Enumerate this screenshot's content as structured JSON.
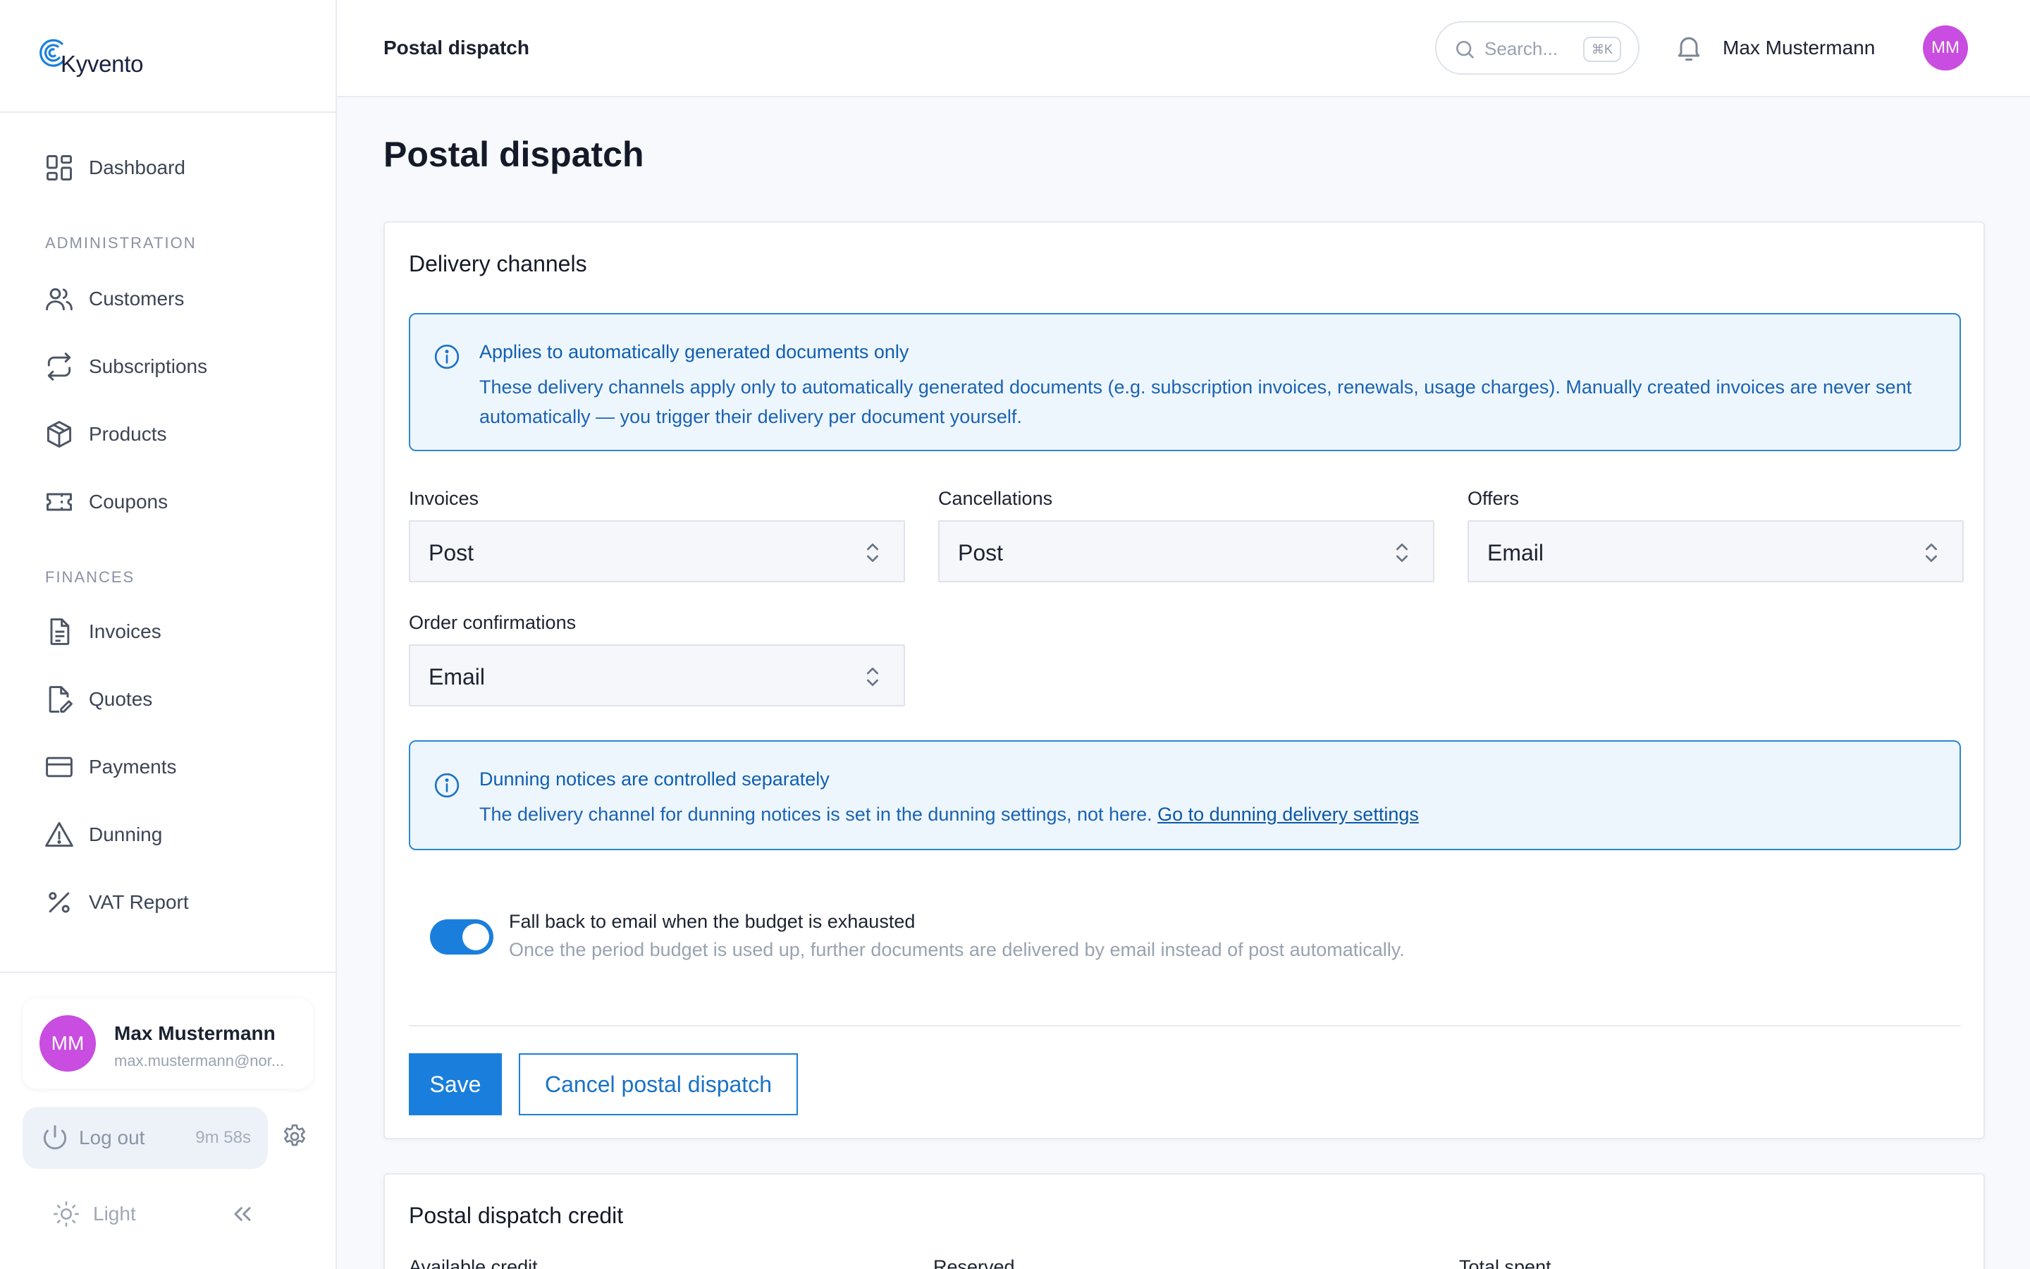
{
  "app": {
    "name": "Kyvento"
  },
  "sidebar": {
    "items": [
      {
        "label": "Dashboard"
      },
      {
        "label": "Customers"
      },
      {
        "label": "Subscriptions"
      },
      {
        "label": "Products"
      },
      {
        "label": "Coupons"
      },
      {
        "label": "Invoices"
      },
      {
        "label": "Quotes"
      },
      {
        "label": "Payments"
      },
      {
        "label": "Dunning"
      },
      {
        "label": "VAT Report"
      }
    ],
    "sections": {
      "administration": "ADMINISTRATION",
      "finances": "FINANCES"
    },
    "user": {
      "initials": "MM",
      "name": "Max Mustermann",
      "email": "max.mustermann@nor..."
    },
    "logout": {
      "label": "Log out",
      "timer": "9m 58s"
    },
    "theme": {
      "label": "Light"
    }
  },
  "topbar": {
    "breadcrumb": "Postal dispatch",
    "search": {
      "placeholder": "Search...",
      "shortcut": "⌘K"
    },
    "user": {
      "name": "Max Mustermann",
      "initials": "MM"
    }
  },
  "main": {
    "title": "Postal dispatch",
    "delivery": {
      "title": "Delivery channels",
      "notice1": {
        "title": "Applies to automatically generated documents only",
        "body": "These delivery channels apply only to automatically generated documents (e.g. subscription invoices, renewals, usage charges). Manually created invoices are never sent automatically — you trigger their delivery per document yourself."
      },
      "fields": {
        "invoices": {
          "label": "Invoices",
          "value": "Post"
        },
        "cancellations": {
          "label": "Cancellations",
          "value": "Post"
        },
        "offers": {
          "label": "Offers",
          "value": "Email"
        },
        "order_confirmations": {
          "label": "Order confirmations",
          "value": "Email"
        }
      },
      "notice2": {
        "title": "Dunning notices are controlled separately",
        "body": "The delivery channel for dunning notices is set in the dunning settings, not here.",
        "link": "Go to dunning delivery settings"
      },
      "fallback": {
        "enabled": true,
        "title": "Fall back to email when the budget is exhausted",
        "description": "Once the period budget is used up, further documents are delivered by email instead of post automatically."
      },
      "save_label": "Save",
      "cancel_label": "Cancel postal dispatch"
    },
    "credit": {
      "title": "Postal dispatch credit",
      "labels": [
        "Available credit",
        "Reserved",
        "Total spent"
      ]
    }
  },
  "colors": {
    "accent": "#1a7fdc",
    "avatar": "#c94de0",
    "notice_bg": "#eef6fd",
    "notice_border": "#2d87d2"
  }
}
